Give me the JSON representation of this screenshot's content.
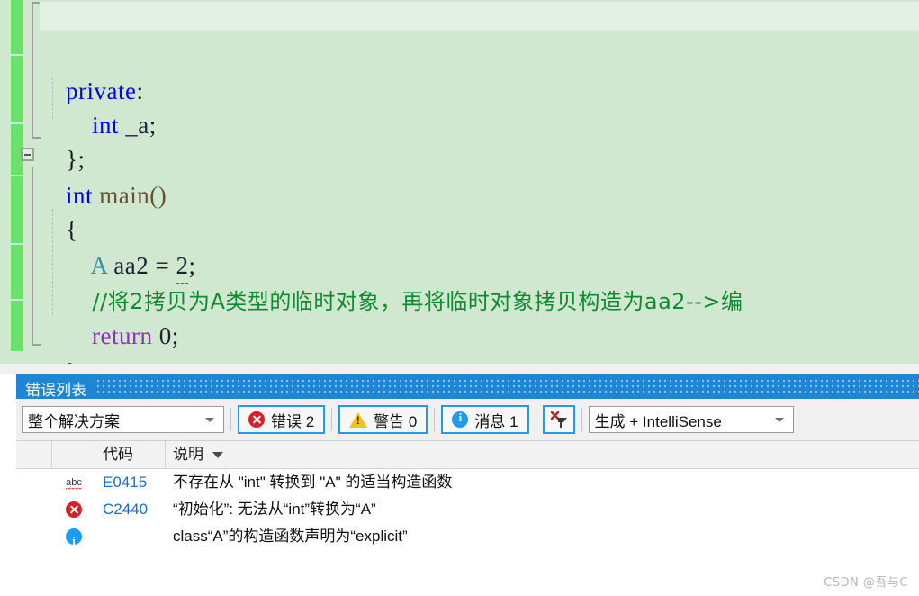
{
  "editor": {
    "lines": [
      {
        "id": "blank-current",
        "text": ""
      },
      {
        "id": "private",
        "text": "private:"
      },
      {
        "id": "member",
        "text": "    int _a;"
      },
      {
        "id": "class-close",
        "text": "};"
      },
      {
        "id": "main-sig",
        "text": "int main()"
      },
      {
        "id": "main-open",
        "text": "{"
      },
      {
        "id": "decl",
        "text": "    A aa2 = 2;"
      },
      {
        "id": "comment",
        "text": "    //将2拷贝为A类型的临时对象，再将临时对象拷贝构造为aa2-->编"
      },
      {
        "id": "return",
        "text": "    return 0;"
      },
      {
        "id": "main-close",
        "text": "}"
      }
    ],
    "tokens": {
      "kw_private": "private",
      "colon": ":",
      "kw_int": "int",
      "ident_a": "_a",
      "semi": ";",
      "brace_close_semi": "};",
      "kw_int2": "int",
      "fn_main": "main",
      "parens": "()",
      "brace_open": "{",
      "type_A": "A",
      "ident_aa2": "aa2",
      "equals": "=",
      "literal_2": "2",
      "kw_return": "return",
      "literal_0": "0",
      "brace_close": "}",
      "comment_text": "//将2拷贝为A类型的临时对象，再将临时对象拷贝构造为aa2-->编"
    },
    "colors": {
      "background": "#cfe8cf",
      "change_bar": "#6ce06c",
      "keyword": "#0000ff",
      "type": "#2b91af",
      "comment": "#108a2f",
      "function": "#6a5030",
      "squiggle": "#e02020",
      "current_line": "#e2f1e2"
    }
  },
  "panel": {
    "title": "错误列表",
    "title_bg": "#1e86d2",
    "toolbar": {
      "scope_filter": "整个解决方案",
      "errors_label": "错误 2",
      "warnings_label": "警告 0",
      "messages_label": "消息 1",
      "clear_filter_label": "",
      "build_filter": "生成 + IntelliSense",
      "error_count": "2",
      "warning_count": "0",
      "message_count": "1",
      "accent": "#1e9af0"
    },
    "grid": {
      "columns": [
        "",
        "",
        "代码",
        "说明"
      ],
      "sort_column": "说明",
      "sort_direction": "desc",
      "rows": [
        {
          "severity": "intellisense",
          "icon": "abc-squiggle-icon",
          "code": "E0415",
          "description": "不存在从 \"int\" 转换到 \"A\" 的适当构造函数"
        },
        {
          "severity": "error",
          "icon": "error-icon",
          "code": "C2440",
          "description": "“初始化”: 无法从“int”转换为“A”"
        },
        {
          "severity": "info",
          "icon": "info-icon",
          "code": "",
          "description": "class“A”的构造函数声明为“explicit”"
        }
      ]
    }
  },
  "watermark": {
    "text": "CSDN @吾与C"
  }
}
